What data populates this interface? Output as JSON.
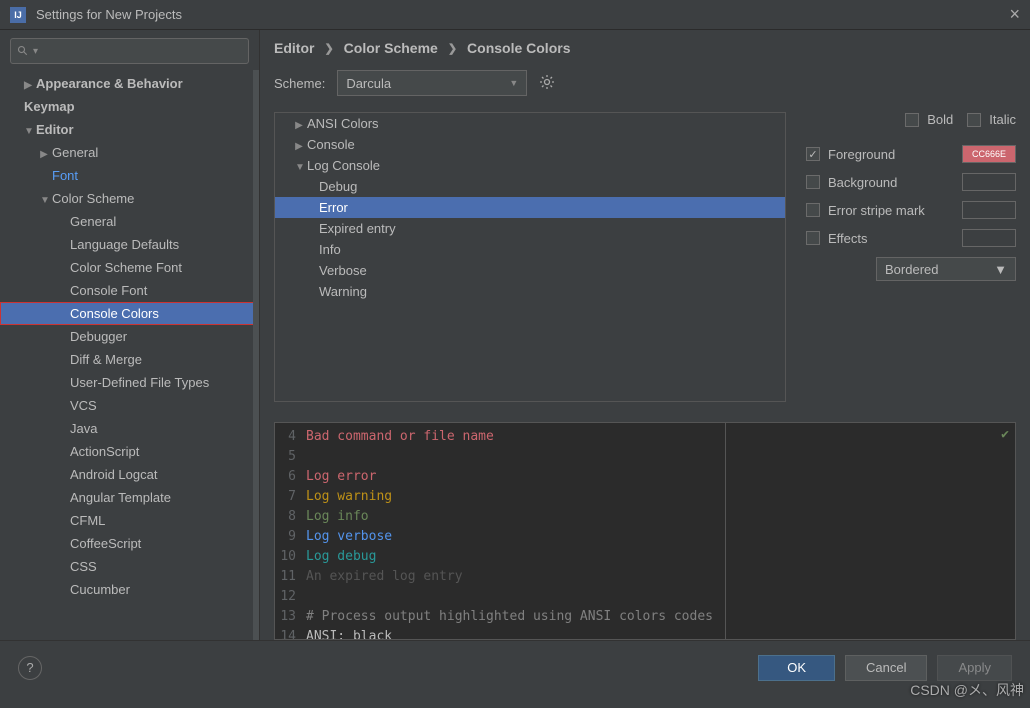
{
  "window": {
    "title": "Settings for New Projects"
  },
  "search": {
    "placeholder": ""
  },
  "sidebar": {
    "items": [
      {
        "label": "Appearance & Behavior",
        "lvl": "lvl0",
        "arrow": "right"
      },
      {
        "label": "Keymap",
        "lvl": "lvl0"
      },
      {
        "label": "Editor",
        "lvl": "lvl0",
        "arrow": "down"
      },
      {
        "label": "General",
        "lvl": "lvl1",
        "arrow": "right"
      },
      {
        "label": "Font",
        "lvl": "lvl1b",
        "blue": true
      },
      {
        "label": "Color Scheme",
        "lvl": "lvl1",
        "arrow": "down"
      },
      {
        "label": "General",
        "lvl": "lvl2"
      },
      {
        "label": "Language Defaults",
        "lvl": "lvl2"
      },
      {
        "label": "Color Scheme Font",
        "lvl": "lvl2"
      },
      {
        "label": "Console Font",
        "lvl": "lvl2"
      },
      {
        "label": "Console Colors",
        "lvl": "lvl2",
        "selected": true,
        "redbox": true
      },
      {
        "label": "Debugger",
        "lvl": "lvl2"
      },
      {
        "label": "Diff & Merge",
        "lvl": "lvl2"
      },
      {
        "label": "User-Defined File Types",
        "lvl": "lvl2"
      },
      {
        "label": "VCS",
        "lvl": "lvl2"
      },
      {
        "label": "Java",
        "lvl": "lvl2"
      },
      {
        "label": "ActionScript",
        "lvl": "lvl2"
      },
      {
        "label": "Android Logcat",
        "lvl": "lvl2"
      },
      {
        "label": "Angular Template",
        "lvl": "lvl2"
      },
      {
        "label": "CFML",
        "lvl": "lvl2"
      },
      {
        "label": "CoffeeScript",
        "lvl": "lvl2"
      },
      {
        "label": "CSS",
        "lvl": "lvl2"
      },
      {
        "label": "Cucumber",
        "lvl": "lvl2"
      }
    ]
  },
  "breadcrumb": {
    "p1": "Editor",
    "p2": "Color Scheme",
    "p3": "Console Colors"
  },
  "scheme": {
    "label": "Scheme:",
    "value": "Darcula"
  },
  "colortree": [
    {
      "label": "ANSI Colors",
      "lvl": "l1",
      "arrow": "right"
    },
    {
      "label": "Console",
      "lvl": "l1",
      "arrow": "right"
    },
    {
      "label": "Log Console",
      "lvl": "l1",
      "arrow": "down"
    },
    {
      "label": "Debug",
      "lvl": "l2"
    },
    {
      "label": "Error",
      "lvl": "l2",
      "sel": true
    },
    {
      "label": "Expired entry",
      "lvl": "l2"
    },
    {
      "label": "Info",
      "lvl": "l2"
    },
    {
      "label": "Verbose",
      "lvl": "l2"
    },
    {
      "label": "Warning",
      "lvl": "l2"
    }
  ],
  "opts": {
    "bold": "Bold",
    "italic": "Italic",
    "fg": "Foreground",
    "fg_hex": "CC666E",
    "bg": "Background",
    "stripe": "Error stripe mark",
    "effects": "Effects",
    "effect_type": "Bordered"
  },
  "preview": {
    "lines": [
      {
        "n": "4",
        "cls": "err",
        "t": "Bad command or file name"
      },
      {
        "n": "5",
        "cls": "",
        "t": ""
      },
      {
        "n": "6",
        "cls": "err",
        "t": "Log error"
      },
      {
        "n": "7",
        "cls": "warn",
        "t": "Log warning"
      },
      {
        "n": "8",
        "cls": "info",
        "t": "Log info"
      },
      {
        "n": "9",
        "cls": "verb",
        "t": "Log verbose"
      },
      {
        "n": "10",
        "cls": "dbg",
        "t": "Log debug"
      },
      {
        "n": "11",
        "cls": "exp",
        "t": "An expired log entry"
      },
      {
        "n": "12",
        "cls": "",
        "t": ""
      },
      {
        "n": "13",
        "cls": "cmt",
        "t": "# Process output highlighted using ANSI colors codes"
      },
      {
        "n": "14",
        "cls": "ansi",
        "t": "ANSI: black"
      }
    ]
  },
  "footer": {
    "ok": "OK",
    "cancel": "Cancel",
    "apply": "Apply"
  },
  "watermark": "CSDN @メ、风神"
}
